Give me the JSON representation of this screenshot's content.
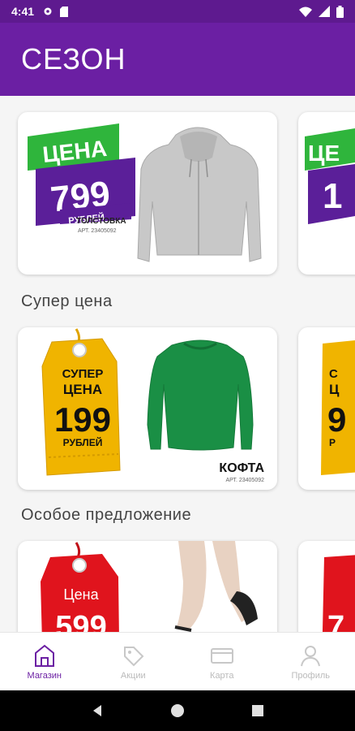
{
  "status": {
    "time": "4:41"
  },
  "appbar": {
    "title": "СЕЗОН"
  },
  "sections": [
    {
      "title": ""
    },
    {
      "title": "Супер цена"
    },
    {
      "title": "Особое предложение"
    }
  ],
  "cards": {
    "hoodie": {
      "badge_top": "ЦЕНА",
      "price": "799",
      "currency": "РУБЛЕЙ",
      "name": "ТОЛСТОВКА",
      "art": "АРТ. 23405092"
    },
    "hoodie_peek": {
      "badge_top": "ЦЕ",
      "price": "1"
    },
    "sweater": {
      "tag_line1": "СУПЕР",
      "tag_line2": "ЦЕНА",
      "price": "199",
      "currency": "РУБЛЕЙ",
      "name": "КОФТА",
      "art": "АРТ. 23405092"
    },
    "sweater_peek": {
      "tag_line1": "С",
      "tag_line2": "Ц",
      "price": "9",
      "currency": "Р"
    },
    "sandal": {
      "tag_line1": "Цена",
      "price": "599"
    },
    "sandal_peek": {
      "price": "7"
    }
  },
  "nav": [
    {
      "label": "Магазин",
      "icon": "store-icon",
      "active": true
    },
    {
      "label": "Акции",
      "icon": "tag-icon",
      "active": false
    },
    {
      "label": "Карта",
      "icon": "card-icon",
      "active": false
    },
    {
      "label": "Профиль",
      "icon": "profile-icon",
      "active": false
    }
  ],
  "colors": {
    "primary": "#6b1fa3",
    "status": "#5e1a8f",
    "green": "#2fb53c",
    "purple_badge": "#5b1f99",
    "gold": "#f0b400",
    "red": "#e0141d"
  }
}
